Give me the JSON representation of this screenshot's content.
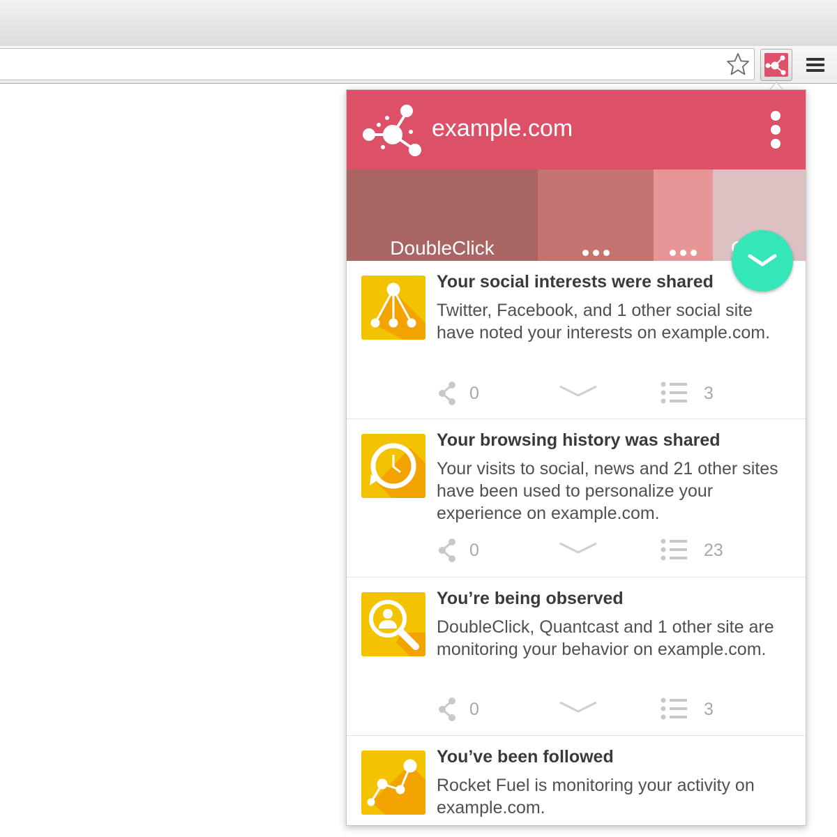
{
  "popup": {
    "site_name": "example.com",
    "colors": {
      "header": "#dc5068",
      "fab": "#35e6b8",
      "card_icon": "#f3b800"
    }
  },
  "trackers": [
    {
      "label": "DoubleClick",
      "color": "#a86563"
    },
    {
      "label": "",
      "color": "#c47470"
    },
    {
      "label": "",
      "color": "#e69795"
    },
    {
      "label": "Q",
      "color": "#dcc1c3"
    }
  ],
  "cards": [
    {
      "icon": "social-network-icon",
      "title": "Your social interests were shared",
      "text": "Twitter, Facebook, and 1 other social site have noted your interests on example.com.",
      "share_count": "0",
      "list_count": "3"
    },
    {
      "icon": "history-clock-icon",
      "title": "Your browsing history was shared",
      "text": "Your visits to social, news and 21 other sites have been used to personalize your experience on example.com.",
      "share_count": "0",
      "list_count": "23"
    },
    {
      "icon": "magnifier-person-icon",
      "title": "You’re being observed",
      "text": "DoubleClick, Quantcast and 1 other site are monitoring your behavior on example.com.",
      "share_count": "0",
      "list_count": "3"
    },
    {
      "icon": "trend-line-icon",
      "title": "You’ve been followed",
      "text": "Rocket Fuel is monitoring your activity on example.com.",
      "share_count": "",
      "list_count": ""
    }
  ]
}
